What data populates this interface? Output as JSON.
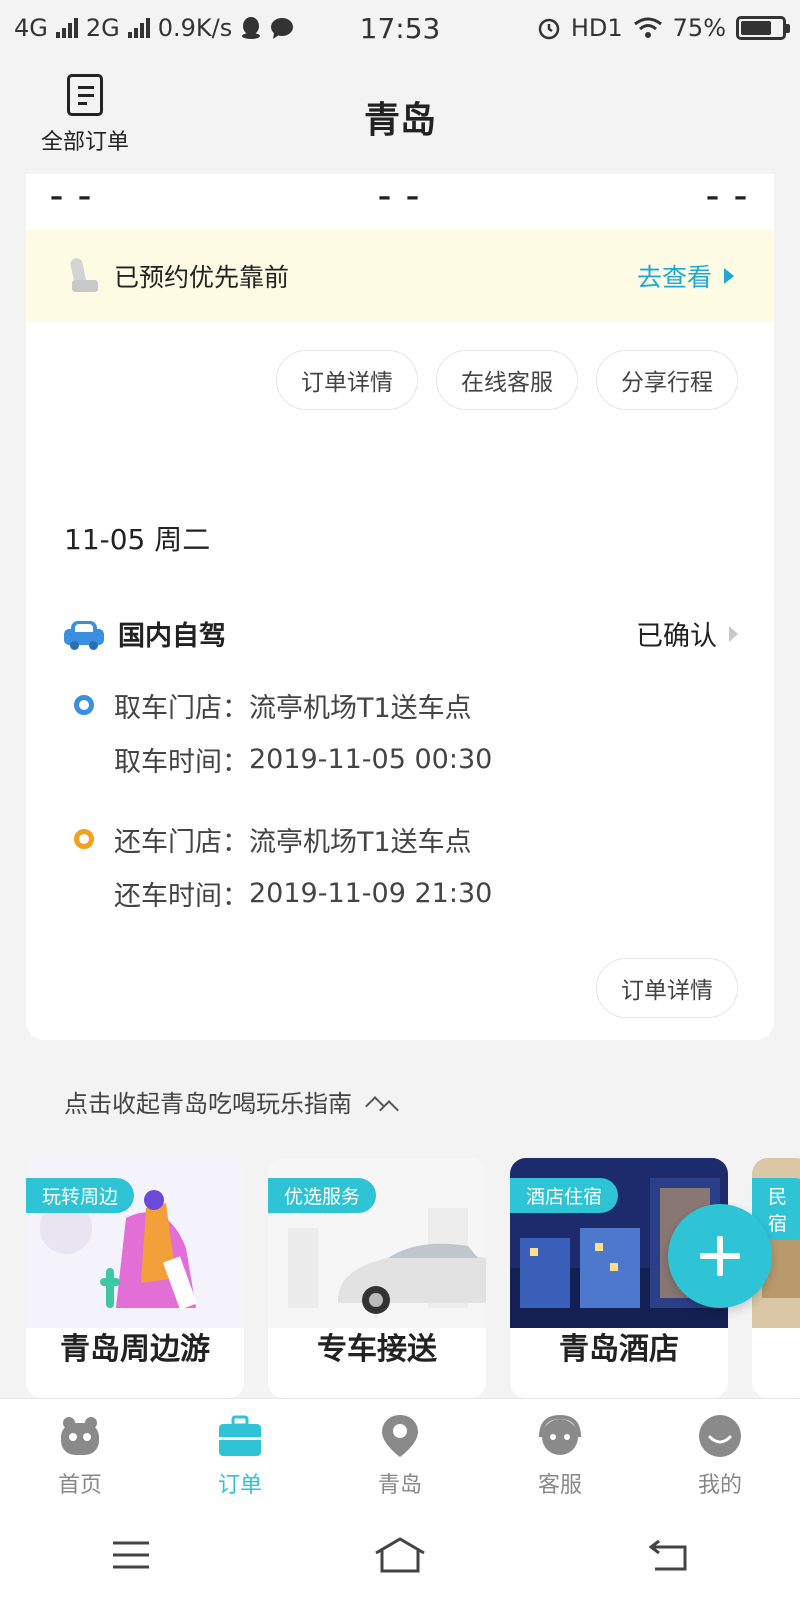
{
  "status_bar": {
    "network_1": "4G",
    "network_2": "2G",
    "speed": "0.9K/s",
    "time": "17:53",
    "hd": "HD1",
    "battery": "75%",
    "battery_level": 0.75
  },
  "header": {
    "all_orders": "全部订单",
    "title": "青岛"
  },
  "top_card": {
    "dashes": [
      "– –",
      "– –",
      "– –"
    ],
    "notice_text": "已预约优先靠前",
    "notice_link": "去查看",
    "buttons": [
      "订单详情",
      "在线客服",
      "分享行程"
    ]
  },
  "date_label": "11-05 周二",
  "order": {
    "type": "国内自驾",
    "status": "已确认",
    "pickup_store_label": "取车门店：",
    "pickup_store": "流亭机场T1送车点",
    "pickup_time_label": "取车时间：",
    "pickup_time": "2019-11-05 00:30",
    "return_store_label": "还车门店：",
    "return_store": "流亭机场T1送车点",
    "return_time_label": "还车时间：",
    "return_time": "2019-11-09 21:30",
    "detail_button": "订单详情"
  },
  "guide": {
    "toggle": "点击收起青岛吃喝玩乐指南",
    "tiles": [
      {
        "tag": "玩转周边",
        "title": "青岛周边游"
      },
      {
        "tag": "优选服务",
        "title": "专车接送"
      },
      {
        "tag": "酒店住宿",
        "title": "青岛酒店"
      },
      {
        "tag": "民宿"
      }
    ]
  },
  "tabbar": {
    "items": [
      {
        "label": "首页",
        "icon": "home-mascot-icon"
      },
      {
        "label": "订单",
        "icon": "briefcase-icon"
      },
      {
        "label": "青岛",
        "icon": "location-pin-icon"
      },
      {
        "label": "客服",
        "icon": "headset-icon"
      },
      {
        "label": "我的",
        "icon": "smile-face-icon"
      }
    ],
    "active_index": 1
  },
  "colors": {
    "accent": "#2fc3d6",
    "link": "#1ea9d4",
    "car_blue": "#3b8fe0",
    "return_orange": "#f5a020",
    "notice_bg": "#fdfbe3"
  }
}
